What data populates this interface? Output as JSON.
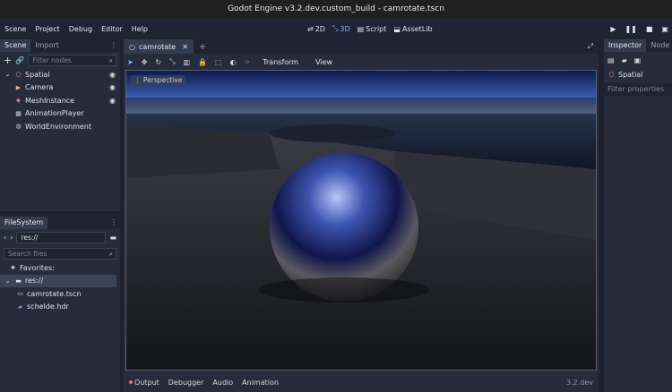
{
  "window": {
    "title": "Godot Engine v3.2.dev.custom_build - camrotate.tscn"
  },
  "menu": {
    "items": [
      "Scene",
      "Project",
      "Debug",
      "Editor",
      "Help"
    ],
    "workspaces": [
      {
        "label": "2D",
        "icon": "2d-icon"
      },
      {
        "label": "3D",
        "icon": "3d-icon",
        "active": true
      },
      {
        "label": "Script",
        "icon": "script-icon"
      },
      {
        "label": "AssetLib",
        "icon": "assetlib-icon"
      }
    ]
  },
  "scene_dock": {
    "tabs": [
      "Scene",
      "Import"
    ],
    "filter_placeholder": "Filter nodes",
    "nodes": [
      {
        "label": "Spatial",
        "icon": "spatial-icon"
      },
      {
        "label": "Camera",
        "icon": "camera-icon"
      },
      {
        "label": "MeshInstance",
        "icon": "mesh-icon"
      },
      {
        "label": "AnimationPlayer",
        "icon": "animation-player-icon"
      },
      {
        "label": "WorldEnvironment",
        "icon": "world-environment-icon"
      }
    ]
  },
  "filesystem": {
    "tab": "FileSystem",
    "path": "res://",
    "search_placeholder": "Search files",
    "items": [
      {
        "label": "Favorites:",
        "icon": "star-icon"
      },
      {
        "label": "res://",
        "icon": "folder-icon"
      },
      {
        "label": "camrotate.tscn",
        "icon": "scene-file-icon"
      },
      {
        "label": "schelde.hdr",
        "icon": "image-file-icon"
      }
    ]
  },
  "editor": {
    "scene_tab": "camrotate",
    "toolbar_menus": [
      "Transform",
      "View"
    ],
    "viewport_label": "Perspective"
  },
  "inspector": {
    "tabs": [
      "Inspector",
      "Node"
    ],
    "object": "Spatial",
    "filter_placeholder": "Filter properties"
  },
  "bottom_panel": {
    "items": [
      "Output",
      "Debugger",
      "Audio",
      "Animation"
    ],
    "version": "3.2.dev"
  },
  "colors": {
    "accent": "#7fb3ff",
    "background": "#262c3b",
    "spatial": "#fc9c9c"
  }
}
